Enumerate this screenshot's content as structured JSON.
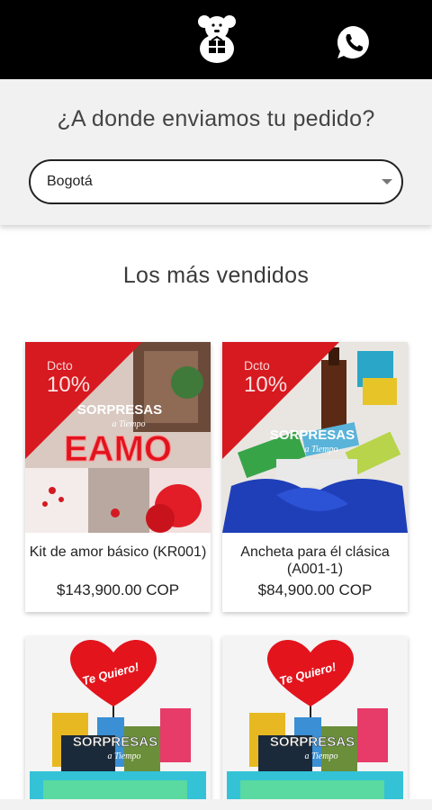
{
  "header": {
    "logo_icon": "bear-logo-icon",
    "whatsapp_icon": "whatsapp-icon",
    "background": "#000000"
  },
  "delivery": {
    "title": "¿A donde enviamos tu pedido?",
    "city_selected": "Bogotá"
  },
  "best_sellers": {
    "title": "Los más vendidos",
    "products": [
      {
        "name": "Kit de amor básico (KR001)",
        "price": "$143,900.00 COP",
        "badge_label": "Dcto",
        "badge_percent": "10%",
        "image_text_top": "SORPRESAS",
        "image_text_script": "a Tiempo",
        "image_text_main": "EAMO"
      },
      {
        "name": "Ancheta para él clásica (A001-1)",
        "price": "$84,900.00 COP",
        "badge_label": "Dcto",
        "badge_percent": "10%",
        "image_text_top": "SORPRESAS",
        "image_text_script": "a Tiempo"
      },
      {
        "image_text_balloon": "Te Quiero!",
        "image_text_top": "SORPRESAS",
        "image_text_script": "a Tiempo"
      },
      {
        "image_text_balloon": "Te Quiero!",
        "image_text_top": "SORPRESAS",
        "image_text_script": "a Tiempo"
      }
    ]
  },
  "colors": {
    "discount_red": "#d71920",
    "balloon_red": "#e3141c",
    "ribbon_blue": "#1f3fb8"
  }
}
